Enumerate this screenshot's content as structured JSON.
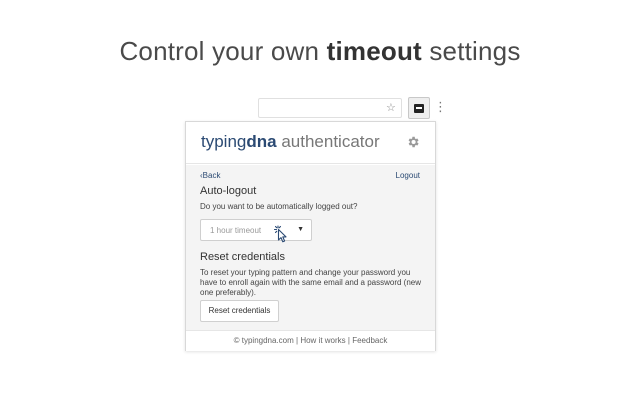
{
  "headline": {
    "prefix": "Control your own ",
    "bold": "timeout",
    "suffix": " settings"
  },
  "toolbar": {
    "star_icon": "star-icon",
    "extension_icon": "dna-extension-icon",
    "menu_glyph": "⋮"
  },
  "popup": {
    "logo": {
      "part1": "typing",
      "part2": "dna",
      "part3": " authenticator"
    },
    "back_label": "Back",
    "logout_label": "Logout",
    "auto_logout": {
      "title": "Auto-logout",
      "question": "Do you want to be automatically logged out?",
      "selected_value": "1 hour timeout"
    },
    "reset": {
      "title": "Reset credentials",
      "description": "To reset your typing pattern and change your password you have to enroll again with the same email and a password (new one preferably).",
      "button_label": "Reset credentials"
    },
    "footer": {
      "site": "© typingdna.com",
      "sep1": " | ",
      "how": "How it works",
      "sep2": " | ",
      "feedback": "Feedback"
    }
  },
  "colors": {
    "brand": "#2b4a73",
    "panel_bg": "#f4f4f4"
  }
}
